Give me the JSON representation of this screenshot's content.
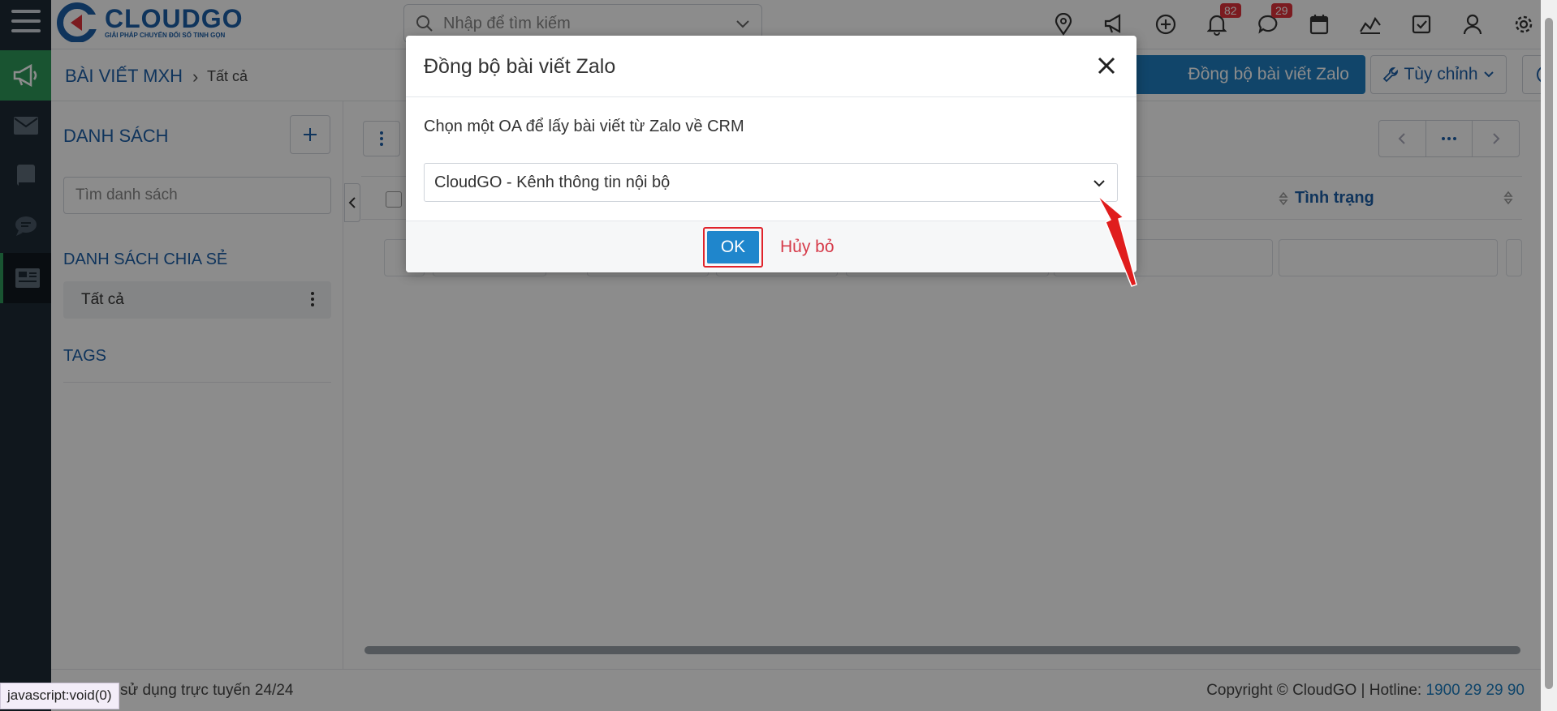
{
  "app": {
    "brand": "CLOUDGO",
    "slogan": "GIẢI PHÁP CHUYỂN ĐỔI SỐ TINH GỌN"
  },
  "search": {
    "placeholder": "Nhập để tìm kiếm"
  },
  "topbar": {
    "notifications_count": "82",
    "messages_count": "29"
  },
  "breadcrumb": {
    "module": "BÀI VIẾT MXH",
    "current": "Tất cả"
  },
  "actions": {
    "sync_label": "Đồng bộ bài viết Zalo",
    "customize_label": "Tùy chỉnh"
  },
  "sidebar": {
    "list_title": "DANH SÁCH",
    "search_placeholder": "Tìm danh sách",
    "shared_title": "DANH SÁCH CHIA SẺ",
    "shared_items": [
      {
        "label": "Tất cả"
      }
    ],
    "tags_title": "TAGS"
  },
  "table": {
    "columns": [
      {
        "label": "Tình trạng"
      }
    ]
  },
  "footer": {
    "left_text": "sử dụng trực tuyến 24/24",
    "copyright": "Copyright © CloudGO",
    "hotline_label": "Hotline:",
    "hotline_number": "1900 29 29 90"
  },
  "statusbar": {
    "text": "javascript:void(0)"
  },
  "modal": {
    "title": "Đồng bộ bài viết Zalo",
    "prompt": "Chọn một OA để lấy bài viết từ Zalo về CRM",
    "selected_oa": "CloudGO - Kênh thông tin nội bộ",
    "ok_label": "OK",
    "cancel_label": "Hủy bỏ"
  },
  "colors": {
    "brand_blue": "#1d5fa8",
    "primary_button": "#1f86cc",
    "highlight_red": "#e0232b",
    "cancel_red": "#d63b4a",
    "rail_dark": "#1e2a36",
    "rail_active": "#2f9a5a"
  }
}
